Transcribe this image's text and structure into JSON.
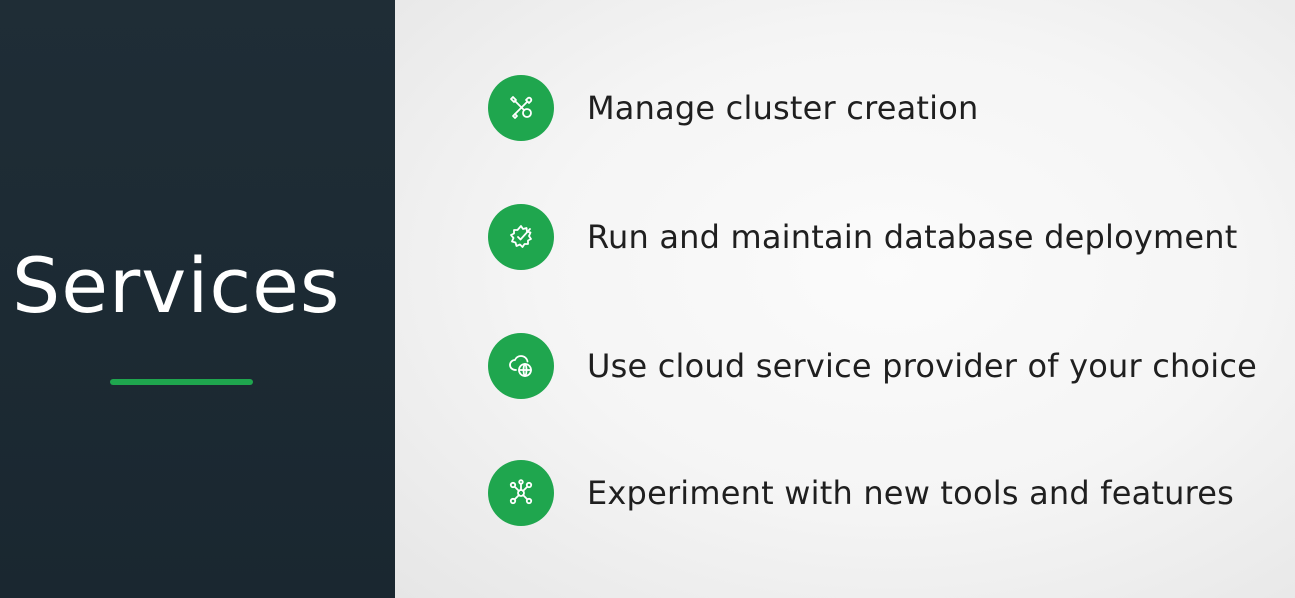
{
  "title": "Services",
  "colors": {
    "accent": "#1fa64e",
    "left_panel": "#1f2d36",
    "text_dark": "#1f1f1f"
  },
  "services": [
    {
      "label": "Manage cluster creation",
      "icon": "tools-icon"
    },
    {
      "label": "Run and maintain database deployment",
      "icon": "gear-check-icon"
    },
    {
      "label": "Use cloud service provider of your choice",
      "icon": "cloud-globe-icon"
    },
    {
      "label": "Experiment with new tools and features",
      "icon": "network-nodes-icon"
    }
  ]
}
